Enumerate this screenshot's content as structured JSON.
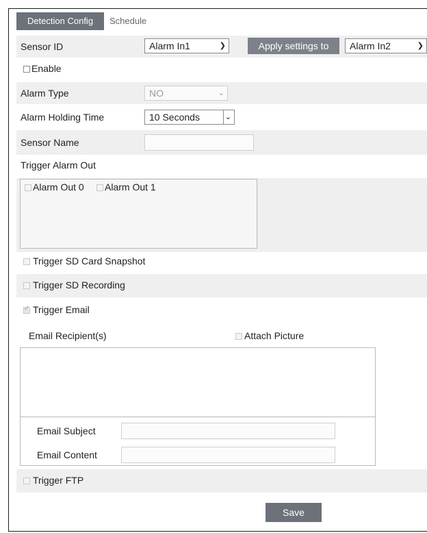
{
  "tabs": {
    "active": "Detection Config",
    "inactive": "Schedule"
  },
  "sensor_id": {
    "label": "Sensor ID",
    "value": "Alarm In1",
    "apply_label": "Apply settings to",
    "apply_value": "Alarm In2"
  },
  "enable": {
    "label": "Enable",
    "checked": false
  },
  "alarm_type": {
    "label": "Alarm Type",
    "value": "NO"
  },
  "holding_time": {
    "label": "Alarm Holding Time",
    "value": "10 Seconds"
  },
  "sensor_name": {
    "label": "Sensor Name",
    "value": ""
  },
  "trigger_alarm_out": {
    "label": "Trigger Alarm Out",
    "outputs": [
      "Alarm Out 0",
      "Alarm Out 1"
    ]
  },
  "trigger_sd_snapshot": {
    "label": "Trigger SD Card Snapshot"
  },
  "trigger_sd_recording": {
    "label": "Trigger SD Recording"
  },
  "trigger_email": {
    "label": "Trigger Email",
    "checked": true
  },
  "email": {
    "recipients_label": "Email Recipient(s)",
    "attach_label": "Attach Picture",
    "subject_label": "Email Subject",
    "content_label": "Email Content"
  },
  "trigger_ftp": {
    "label": "Trigger FTP"
  },
  "save_label": "Save",
  "chevron_icon": "chevron-down-icon"
}
